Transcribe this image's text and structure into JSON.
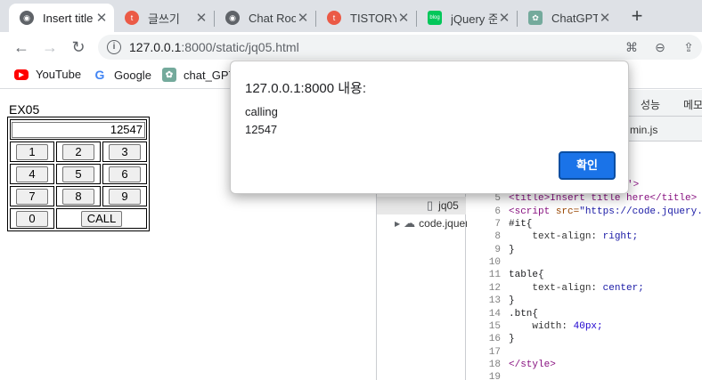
{
  "browser": {
    "tabs": [
      {
        "title": "Insert title here",
        "active": true
      },
      {
        "title": "글쓰기"
      },
      {
        "title": "Chat Room"
      },
      {
        "title": "TISTORY"
      },
      {
        "title": "jQuery 준비"
      },
      {
        "title": "ChatGPT"
      }
    ],
    "url_host": "127.0.0.1",
    "url_port_path": ":8000/static/jq05.html",
    "bookmarks": [
      "YouTube",
      "Google",
      "chat_GPT"
    ]
  },
  "page": {
    "heading": "EX05",
    "display_value": "12547",
    "keys_row1": [
      "1",
      "2",
      "3"
    ],
    "keys_row2": [
      "4",
      "5",
      "6"
    ],
    "keys_row3": [
      "7",
      "8",
      "9"
    ],
    "key_zero": "0",
    "key_call": "CALL"
  },
  "devtools": {
    "tab_performance": "성능",
    "tab_memory": "메모",
    "open_file_fragment": "min.js",
    "tree": [
      "jq05",
      "code.jquery"
    ],
    "code_lines": [
      {
        "n": "5"
      },
      {
        "n": "6"
      },
      {
        "n": "7"
      },
      {
        "n": "8"
      },
      {
        "n": "9"
      },
      {
        "n": "10"
      },
      {
        "n": "11"
      },
      {
        "n": "12"
      },
      {
        "n": "13"
      },
      {
        "n": "14"
      },
      {
        "n": "15"
      },
      {
        "n": "16"
      },
      {
        "n": "17"
      },
      {
        "n": "18"
      },
      {
        "n": "19"
      }
    ],
    "code_text": {
      "l5": "<title>Insert title here</title>",
      "l6_a": "<script ",
      "l6_b": "src=",
      "l6_c": "\"https://code.jquery.",
      "l7": "#it{",
      "l8_a": "    text-align: ",
      "l8_b": "right;",
      "l9": "}",
      "l11": "table{",
      "l12_a": "    text-align: ",
      "l12_b": "center;",
      "l13": "}",
      "l14": ".btn{",
      "l15_a": "    width: ",
      "l15_b": "40px;",
      "l16": "}",
      "l18": "</style>",
      "l4_frag": "'>"
    }
  },
  "dialog": {
    "title": "127.0.0.1:8000 내용:",
    "line1": "calling",
    "line2": "12547",
    "ok_label": "확인"
  }
}
